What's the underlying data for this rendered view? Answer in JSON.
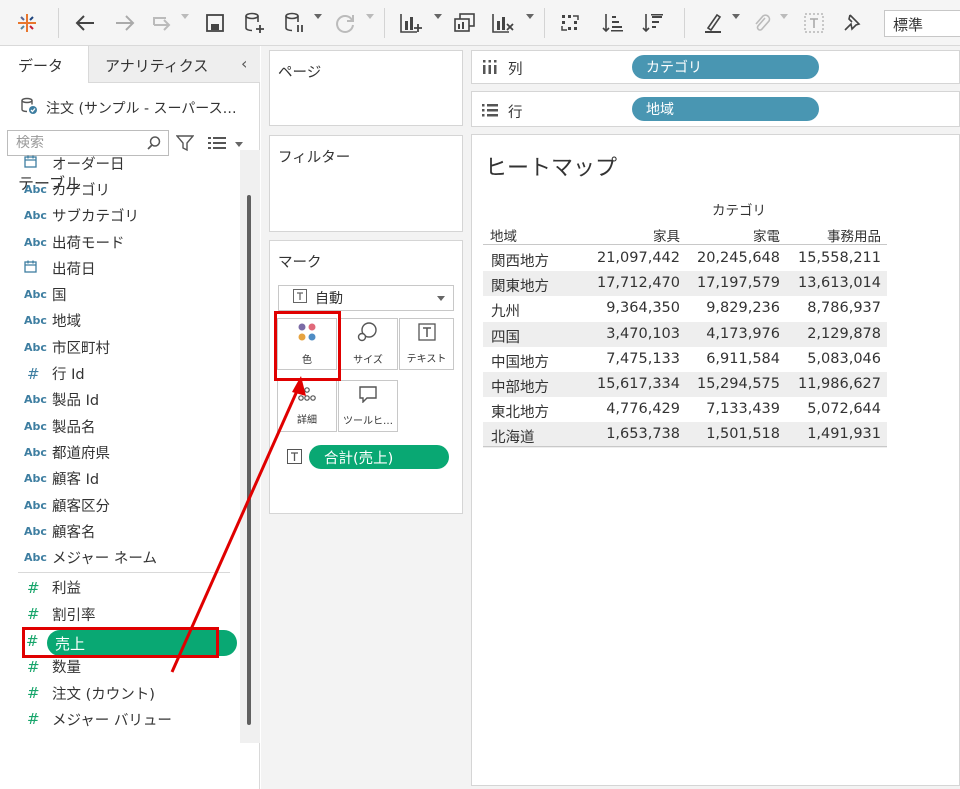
{
  "toolbar": {
    "combo_value": "標準"
  },
  "datapane": {
    "tab_data": "データ",
    "tab_analytics": "アナリティクス",
    "collapse": "‹",
    "datasource": "注文 (サンプル - スーパース…",
    "search_placeholder": "検索",
    "table_header": "テーブル",
    "fields": [
      {
        "icon": "date",
        "label": "オーダー日"
      },
      {
        "icon": "Abc",
        "label": "カテゴリ"
      },
      {
        "icon": "Abc",
        "label": "サブカテゴリ"
      },
      {
        "icon": "Abc",
        "label": "出荷モード"
      },
      {
        "icon": "date",
        "label": "出荷日"
      },
      {
        "icon": "Abc",
        "label": "国"
      },
      {
        "icon": "Abc",
        "label": "地域"
      },
      {
        "icon": "Abc",
        "label": "市区町村"
      },
      {
        "icon": "#",
        "label": "行 Id"
      },
      {
        "icon": "Abc",
        "label": "製品 Id"
      },
      {
        "icon": "Abc",
        "label": "製品名"
      },
      {
        "icon": "Abc",
        "label": "都道府県"
      },
      {
        "icon": "Abc",
        "label": "顧客 Id"
      },
      {
        "icon": "Abc",
        "label": "顧客区分"
      },
      {
        "icon": "Abc",
        "label": "顧客名"
      },
      {
        "icon": "Abc",
        "label": "メジャー ネーム"
      }
    ],
    "measures": [
      {
        "icon": "#",
        "label": "利益"
      },
      {
        "icon": "#",
        "label": "割引率"
      },
      {
        "icon": "#",
        "label": "売上"
      },
      {
        "icon": "#",
        "label": "数量"
      },
      {
        "icon": "#",
        "label": "注文 (カウント)"
      },
      {
        "icon": "#",
        "label": "メジャー バリュー"
      }
    ],
    "hash": "#",
    "abc": "Abc"
  },
  "cards": {
    "pages": "ページ",
    "filters": "フィルター",
    "marks": "マーク",
    "marks_type": "自動",
    "btn_color": "色",
    "btn_size": "サイズ",
    "btn_text": "テキスト",
    "btn_detail": "詳細",
    "btn_tooltip": "ツールヒ…",
    "sum_pill": "合計(売上)",
    "t_glyph": "T"
  },
  "shelves": {
    "columns_label": "列",
    "columns_pill": "カテゴリ",
    "rows_label": "行",
    "rows_pill": "地域"
  },
  "viz": {
    "title": "ヒートマップ",
    "column_header": "カテゴリ",
    "row_header": "地域",
    "categories": [
      "家具",
      "家電",
      "事務用品"
    ],
    "rows": [
      {
        "region": "関西地方",
        "values": [
          "21,097,442",
          "20,245,648",
          "15,558,211"
        ]
      },
      {
        "region": "関東地方",
        "values": [
          "17,712,470",
          "17,197,579",
          "13,613,014"
        ]
      },
      {
        "region": "九州",
        "values": [
          "9,364,350",
          "9,829,236",
          "8,786,937"
        ]
      },
      {
        "region": "四国",
        "values": [
          "3,470,103",
          "4,173,976",
          "2,129,878"
        ]
      },
      {
        "region": "中国地方",
        "values": [
          "7,475,133",
          "6,911,584",
          "5,083,046"
        ]
      },
      {
        "region": "中部地方",
        "values": [
          "15,617,334",
          "15,294,575",
          "11,986,627"
        ]
      },
      {
        "region": "東北地方",
        "values": [
          "4,776,429",
          "7,133,439",
          "5,072,644"
        ]
      },
      {
        "region": "北海道",
        "values": [
          "1,653,738",
          "1,501,518",
          "1,491,931"
        ]
      }
    ]
  },
  "colors": {
    "measure_green": "#09a873",
    "dimension_blue": "#4996b2",
    "highlight_red": "#e00000",
    "row_shade": "#eeeeee"
  }
}
